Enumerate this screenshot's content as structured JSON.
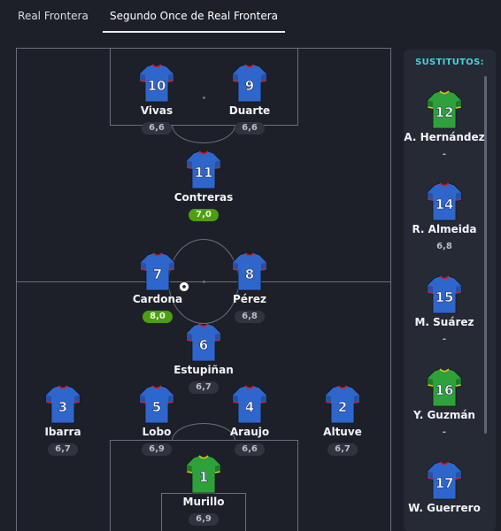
{
  "tabs": [
    {
      "label": "Real Frontera",
      "active": false
    },
    {
      "label": "Segundo Once de Real Frontera",
      "active": true
    }
  ],
  "pitch": {
    "players": [
      {
        "number": "10",
        "name": "Vivas",
        "rating": "6,6",
        "kit": "outfield"
      },
      {
        "number": "9",
        "name": "Duarte",
        "rating": "6,6",
        "kit": "outfield"
      },
      {
        "number": "11",
        "name": "Contreras",
        "rating": "7,0",
        "kit": "outfield",
        "rating_highlight": true
      },
      {
        "number": "7",
        "name": "Cardona",
        "rating": "8,0",
        "kit": "outfield",
        "rating_highlight": true,
        "scored_goal": true
      },
      {
        "number": "8",
        "name": "Pérez",
        "rating": "6,8",
        "kit": "outfield"
      },
      {
        "number": "6",
        "name": "Estupiñan",
        "rating": "6,7",
        "kit": "outfield"
      },
      {
        "number": "3",
        "name": "Ibarra",
        "rating": "6,7",
        "kit": "outfield"
      },
      {
        "number": "5",
        "name": "Lobo",
        "rating": "6,9",
        "kit": "outfield"
      },
      {
        "number": "4",
        "name": "Araujo",
        "rating": "6,6",
        "kit": "outfield"
      },
      {
        "number": "2",
        "name": "Altuve",
        "rating": "6,7",
        "kit": "outfield"
      },
      {
        "number": "1",
        "name": "Murillo",
        "rating": "6,9",
        "kit": "goalkeeper"
      }
    ]
  },
  "substitutes": {
    "title": "SUSTITUTOS:",
    "players": [
      {
        "number": "12",
        "name": "A. Hernández",
        "rating": "-",
        "kit": "goalkeeper"
      },
      {
        "number": "14",
        "name": "R. Almeida",
        "rating": "6,8",
        "kit": "outfield"
      },
      {
        "number": "15",
        "name": "M. Suárez",
        "rating": "-",
        "kit": "outfield"
      },
      {
        "number": "16",
        "name": "Y. Guzmán",
        "rating": "-",
        "kit": "goalkeeper"
      },
      {
        "number": "17",
        "name": "W. Guerrero",
        "rating": "",
        "kit": "outfield"
      }
    ]
  },
  "colors": {
    "outfield_shirt": "#2f66cc",
    "outfield_trim": "#c8202c",
    "goalkeeper_shirt": "#2fa13a",
    "goalkeeper_trim": "#d9c21e",
    "highlight_rating": "#4e9d12",
    "accent": "#45d3d8"
  }
}
